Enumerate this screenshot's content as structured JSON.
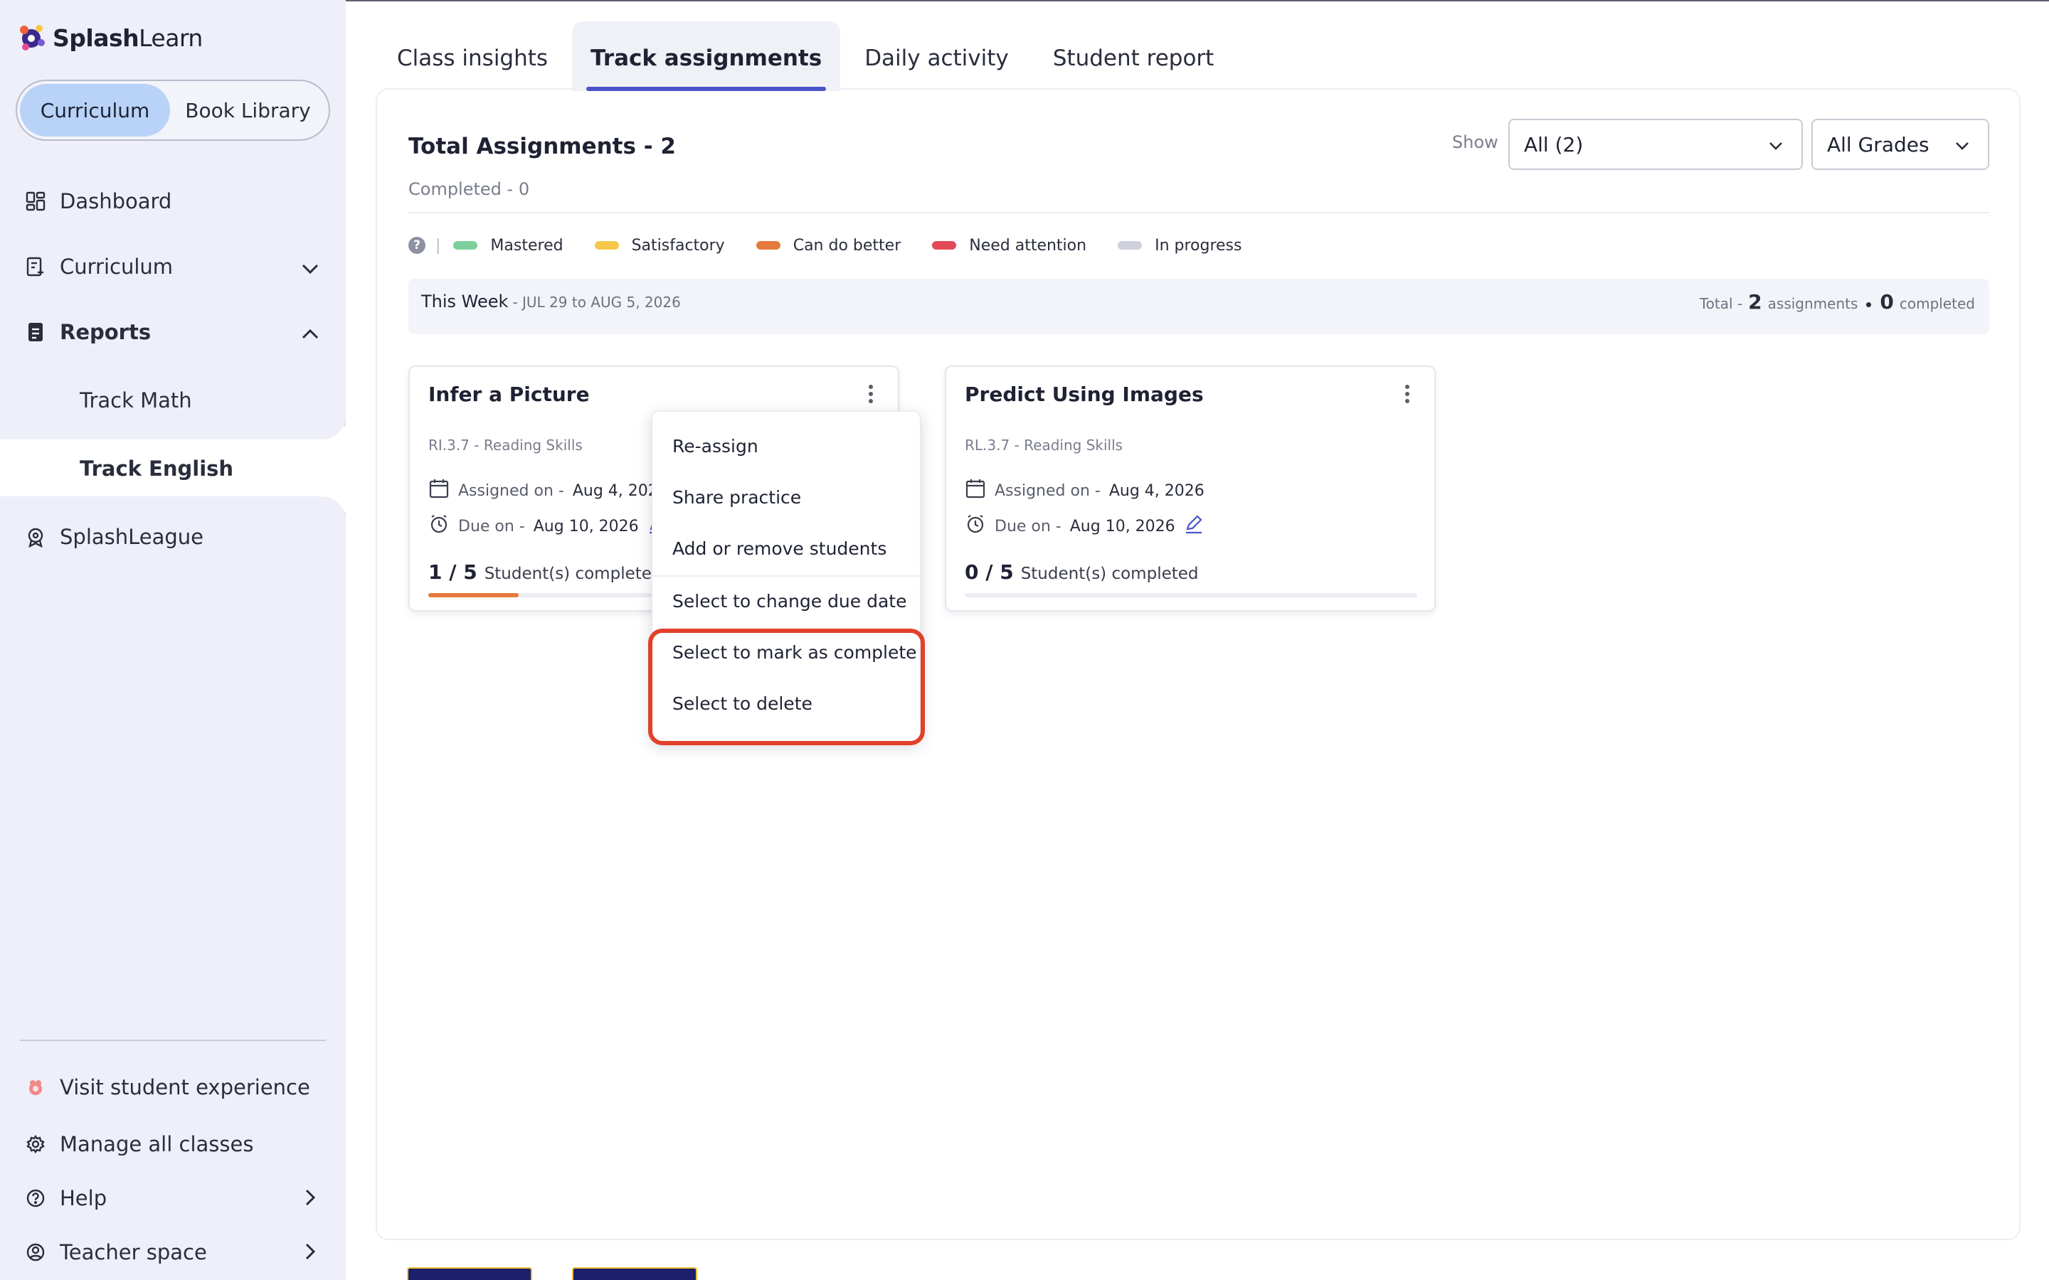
{
  "app": {
    "brand_bold": "Splash",
    "brand_light": "Learn"
  },
  "sidebar": {
    "toggle": {
      "active": "Curriculum",
      "inactive": "Book Library"
    },
    "items": [
      {
        "label": "Dashboard"
      },
      {
        "label": "Curriculum"
      },
      {
        "label": "Reports"
      },
      {
        "label": "SplashLeague"
      }
    ],
    "report_subitems": [
      {
        "label": "Track Math"
      },
      {
        "label": "Track English"
      }
    ],
    "bottom": [
      {
        "label": "Visit student experience"
      },
      {
        "label": "Manage all classes"
      },
      {
        "label": "Help"
      },
      {
        "label": "Teacher space"
      }
    ]
  },
  "tabs": [
    {
      "label": "Class insights"
    },
    {
      "label": "Track assignments"
    },
    {
      "label": "Daily activity"
    },
    {
      "label": "Student report"
    }
  ],
  "summary": {
    "title": "Total Assignments - 2",
    "completed": "Completed - 0",
    "show_label": "Show",
    "filter_status": "All (2)",
    "filter_grade": "All Grades"
  },
  "legend": [
    {
      "label": "Mastered",
      "color": "#7ccf9a"
    },
    {
      "label": "Satisfactory",
      "color": "#f5c84a"
    },
    {
      "label": "Can do better",
      "color": "#e47a3c"
    },
    {
      "label": "Need attention",
      "color": "#e24a58"
    },
    {
      "label": "In progress",
      "color": "#cfd0dc"
    }
  ],
  "week": {
    "label": "This Week",
    "range": "- JUL 29 to AUG 5, 2026",
    "total_prefix": "Total -",
    "total_num": "2",
    "total_suffix": "assignments",
    "completed_num": "0",
    "completed_suffix": "completed"
  },
  "cards": [
    {
      "title": "Infer a Picture",
      "skill": "RI.3.7 - Reading Skills",
      "assigned_prefix": "Assigned on -",
      "assigned_date": "Aug 4, 2026",
      "due_prefix": "Due on -",
      "due_date": "Aug 10, 2026",
      "fraction": "1 / 5",
      "completed_label": "Student(s) completed",
      "progress": 0.2
    },
    {
      "title": "Predict Using Images",
      "skill": "RL.3.7 - Reading Skills",
      "assigned_prefix": "Assigned on -",
      "assigned_date": "Aug 4, 2026",
      "due_prefix": "Due on -",
      "due_date": "Aug 10, 2026",
      "fraction": "0 / 5",
      "completed_label": "Student(s) completed",
      "progress": 0
    }
  ],
  "menu": [
    {
      "label": "Re-assign"
    },
    {
      "label": "Share practice"
    },
    {
      "label": "Add or remove students"
    },
    {
      "label": "Select to change due date"
    },
    {
      "label": "Select to mark as complete"
    },
    {
      "label": "Select to delete"
    }
  ],
  "colors": {
    "accent": "#4a54c9",
    "highlight": "#e2402b",
    "sidebar_bg": "#eeeff8",
    "toggle_active": "#b8d3f7"
  }
}
